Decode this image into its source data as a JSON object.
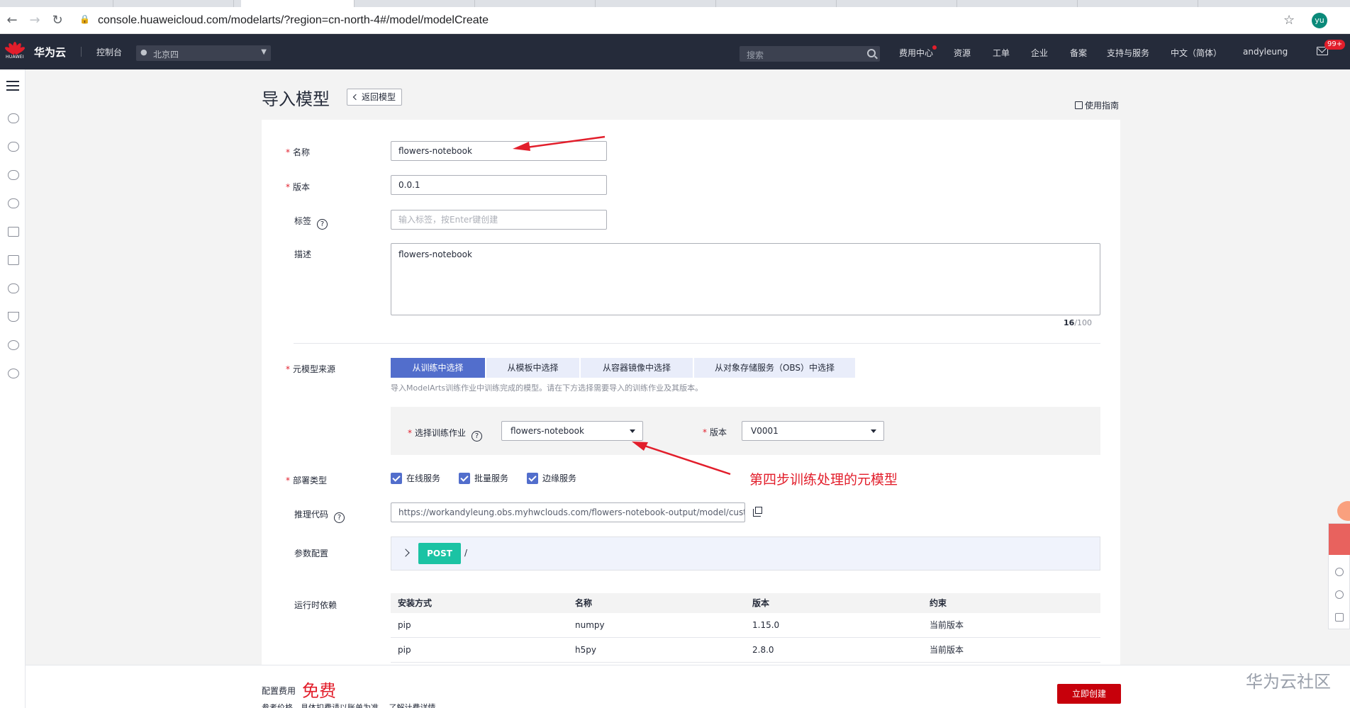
{
  "browser": {
    "url": "console.huaweicloud.com/modelarts/?region=cn-north-4#/model/modelCreate",
    "profile_initials": "yu"
  },
  "topnav": {
    "logo_text": "HUAWEI",
    "brand": "华为云",
    "console": "控制台",
    "region": "北京四",
    "search_placeholder": "搜索",
    "items": [
      "费用中心",
      "资源",
      "工单",
      "企业",
      "备案",
      "支持与服务",
      "中文（简体）",
      "andyleung"
    ],
    "message_badge": "99+"
  },
  "page": {
    "title": "导入模型",
    "back_label": "返回模型",
    "guide_label": "使用指南"
  },
  "form": {
    "name_label": "名称",
    "name_value": "flowers-notebook",
    "version_label": "版本",
    "version_value": "0.0.1",
    "tag_label": "标签",
    "tag_placeholder": "输入标签，按Enter键创建",
    "desc_label": "描述",
    "desc_value": "flowers-notebook",
    "desc_count": "16",
    "desc_max": "/100",
    "source_label": "元模型来源",
    "source_tabs": [
      "从训练中选择",
      "从模板中选择",
      "从容器镜像中选择",
      "从对象存储服务（OBS）中选择"
    ],
    "source_hint": "导入ModelArts训练作业中训练完成的模型。请在下方选择需要导入的训练作业及其版本。",
    "job_label": "选择训练作业",
    "job_value": "flowers-notebook",
    "job_version_label": "版本",
    "job_version_value": "V0001",
    "deploy_label": "部署类型",
    "deploy_options": [
      "在线服务",
      "批量服务",
      "边缘服务"
    ],
    "inference_label": "推理代码",
    "inference_value": "https://workandyleung.obs.myhwclouds.com/flowers-notebook-output/model/customize",
    "params_label": "参数配置",
    "api_method": "POST",
    "api_path": "/",
    "runtime_label": "运行时依赖",
    "deps_headers": [
      "安装方式",
      "名称",
      "版本",
      "约束"
    ],
    "deps_rows": [
      [
        "pip",
        "numpy",
        "1.15.0",
        "当前版本"
      ],
      [
        "pip",
        "h5py",
        "2.8.0",
        "当前版本"
      ]
    ]
  },
  "annotation": {
    "text": "第四步训练处理的元模型",
    "color": "#e21e2b"
  },
  "footer": {
    "fee_label": "配置费用",
    "fee_value": "免费",
    "ref_price": "参考价格，具体扣费请以账单为准。 了解计费详情",
    "create_button": "立即创建",
    "watermark": "华为云社区"
  },
  "colors": {
    "nav_bg": "#252b3a",
    "primary": "#526ecc",
    "danger": "#c7000b",
    "post_badge": "#1bc3a4"
  }
}
